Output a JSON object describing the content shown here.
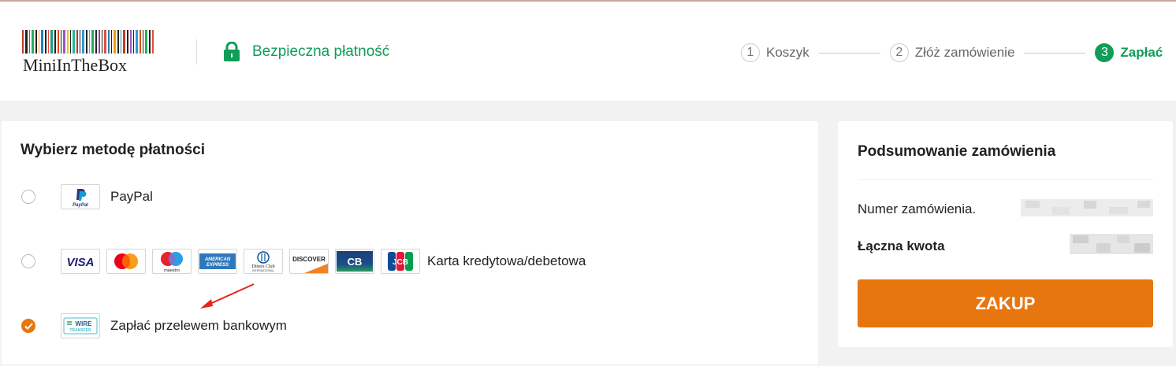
{
  "header": {
    "logo_text": "MiniInTheBox",
    "secure_label": "Bezpieczna płatność",
    "steps": [
      {
        "num": "1",
        "label": "Koszyk"
      },
      {
        "num": "2",
        "label": "Złóż zamówienie"
      },
      {
        "num": "3",
        "label": "Zapłać",
        "active": true
      }
    ]
  },
  "payment": {
    "title": "Wybierz metodę płatności",
    "options": [
      {
        "label": "PayPal",
        "selected": false,
        "icons": [
          "paypal-icon"
        ]
      },
      {
        "label": "Karta kredytowa/debetowa",
        "selected": false,
        "icons": [
          "visa-icon",
          "mastercard-icon",
          "maestro-icon",
          "american-express-icon",
          "diners-club-icon",
          "discover-icon",
          "cb-icon",
          "jcb-icon"
        ]
      },
      {
        "label": "Zapłać przelewem bankowym",
        "selected": true,
        "icons": [
          "wire-transfer-icon"
        ]
      }
    ],
    "badge_texts": {
      "paypal": "PayPal",
      "visa": "VISA",
      "maestro": "maestro",
      "amex_line1": "AMERICAN",
      "amex_line2": "EXPRESS",
      "diners_line1": "Diners Club",
      "diners_line2": "INTERNATIONAL",
      "discover": "DISCOVER",
      "cb": "CB",
      "jcb": "JCB",
      "wire_line1": "WIRE",
      "wire_line2": "TRANSFER"
    }
  },
  "summary": {
    "title": "Podsumowanie zamówienia",
    "order_number_label": "Numer zamówienia.",
    "total_label": "Łączna kwota",
    "buy_button": "ZAKUP"
  },
  "colors": {
    "accent_orange": "#e8760f",
    "secure_green": "#0f9d58",
    "annotation_red": "#e8231a"
  }
}
